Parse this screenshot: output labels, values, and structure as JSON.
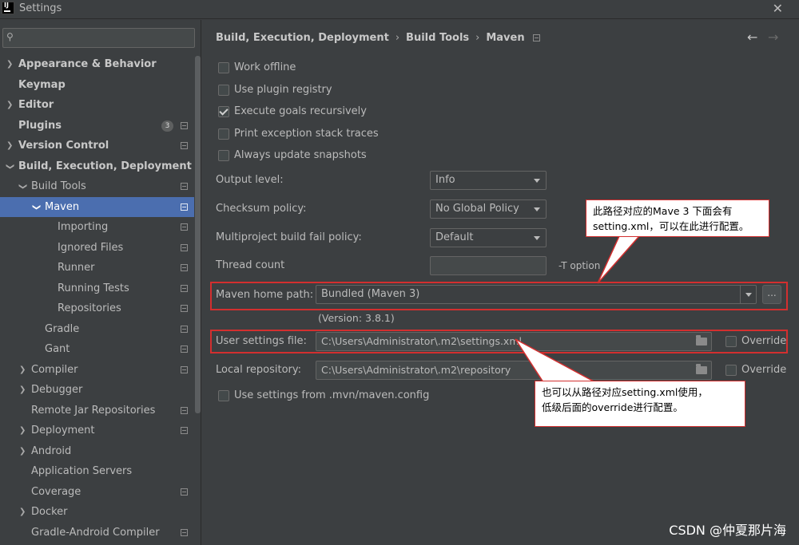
{
  "window": {
    "icon_text": "IJ",
    "title": "Settings"
  },
  "search": {
    "placeholder": ""
  },
  "sidebar": {
    "items": [
      {
        "label": "Appearance & Behavior"
      },
      {
        "label": "Keymap"
      },
      {
        "label": "Editor"
      },
      {
        "label": "Plugins",
        "badge": "3"
      },
      {
        "label": "Version Control"
      },
      {
        "label": "Build, Execution, Deployment"
      },
      {
        "label": "Build Tools"
      },
      {
        "label": "Maven"
      },
      {
        "label": "Importing"
      },
      {
        "label": "Ignored Files"
      },
      {
        "label": "Runner"
      },
      {
        "label": "Running Tests"
      },
      {
        "label": "Repositories"
      },
      {
        "label": "Gradle"
      },
      {
        "label": "Gant"
      },
      {
        "label": "Compiler"
      },
      {
        "label": "Debugger"
      },
      {
        "label": "Remote Jar Repositories"
      },
      {
        "label": "Deployment"
      },
      {
        "label": "Android"
      },
      {
        "label": "Application Servers"
      },
      {
        "label": "Coverage"
      },
      {
        "label": "Docker"
      },
      {
        "label": "Gradle-Android Compiler"
      }
    ]
  },
  "breadcrumb": [
    "Build, Execution, Deployment",
    "Build Tools",
    "Maven"
  ],
  "options": {
    "work_offline": "Work offline",
    "use_plugin_registry": "Use plugin registry",
    "execute_goals": "Execute goals recursively",
    "print_exception": "Print exception stack traces",
    "always_update": "Always update snapshots"
  },
  "fields": {
    "output_level": {
      "label": "Output level:",
      "value": "Info"
    },
    "checksum_policy": {
      "label": "Checksum policy:",
      "value": "No Global Policy"
    },
    "multiproject": {
      "label": "Multiproject build fail policy:",
      "value": "Default"
    },
    "thread_count": {
      "label": "Thread count",
      "value": "",
      "hint": "-T option"
    },
    "maven_home": {
      "label": "Maven home path:",
      "value": "Bundled (Maven 3)",
      "browse": "...",
      "version": "(Version: 3.8.1)"
    },
    "user_settings": {
      "label": "User settings file:",
      "value": "C:\\Users\\Administrator\\.m2\\settings.xml",
      "override": "Override"
    },
    "local_repo": {
      "label": "Local repository:",
      "value": "C:\\Users\\Administrator\\.m2\\repository",
      "override": "Override"
    },
    "use_mvn_config": "Use settings from .mvn/maven.config"
  },
  "callouts": {
    "top": [
      "此路径对应的Mave 3 下面会有",
      "setting.xml，可以在此进行配置。"
    ],
    "bottom": [
      "也可以从路径对应setting.xml使用，",
      "低级后面的override进行配置。"
    ]
  },
  "watermark": "CSDN @仲夏那片海",
  "colors": {
    "selection": "#4b6eaf",
    "background": "#3c3f41",
    "annotation": "#d32f2f"
  }
}
